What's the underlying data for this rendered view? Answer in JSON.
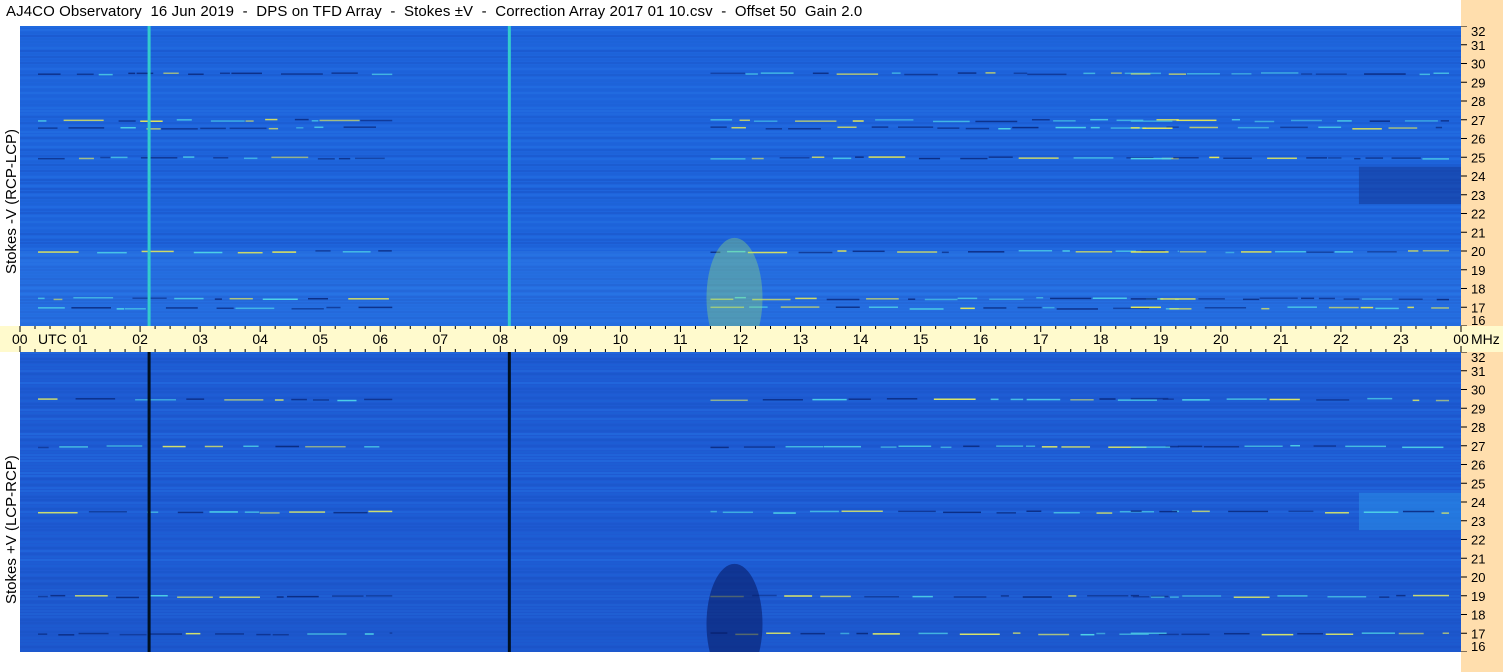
{
  "title": "AJ4CO Observatory  16 Jun 2019  -  DPS on TFD Array  -  Stokes ±V  -  Correction Array 2017 01 10.csv  -  Offset 50  Gain 2.0",
  "chart_data": [
    {
      "type": "heatmap",
      "name": "Stokes -V (RCP-LCP)",
      "ylabel": "Stokes -V (RCP-LCP)",
      "x_ticks": [
        "00",
        "01",
        "02",
        "03",
        "04",
        "05",
        "06",
        "07",
        "08",
        "09",
        "10",
        "11",
        "12",
        "13",
        "14",
        "15",
        "16",
        "17",
        "18",
        "19",
        "20",
        "21",
        "22",
        "23",
        "00"
      ],
      "x_unit": "UTC",
      "xlim": [
        0,
        24
      ],
      "y_ticks": [
        16,
        17,
        18,
        19,
        20,
        21,
        22,
        23,
        24,
        25,
        26,
        27,
        28,
        29,
        30,
        31,
        32
      ],
      "y_unit": "MHz",
      "ylim": [
        16,
        32
      ],
      "vertical_lines_utc": [
        2.15,
        8.15
      ],
      "vertical_line_color": "#33cccc",
      "bright_bands_mhz": [
        17.0,
        17.5,
        20.0,
        25.0,
        26.6,
        27.0,
        29.5
      ],
      "background_color": "#1e64dc",
      "highlight_color": "#f0f050"
    },
    {
      "type": "heatmap",
      "name": "Stokes +V (LCP-RCP)",
      "ylabel": "Stokes +V (LCP-RCP)",
      "x_ticks": [
        "00",
        "01",
        "02",
        "03",
        "04",
        "05",
        "06",
        "07",
        "08",
        "09",
        "10",
        "11",
        "12",
        "13",
        "14",
        "15",
        "16",
        "17",
        "18",
        "19",
        "20",
        "21",
        "22",
        "23",
        "00"
      ],
      "x_unit": "UTC",
      "xlim": [
        0,
        24
      ],
      "y_ticks": [
        16,
        17,
        18,
        19,
        20,
        21,
        22,
        23,
        24,
        25,
        26,
        27,
        28,
        29,
        30,
        31,
        32
      ],
      "y_unit": "MHz",
      "ylim": [
        16,
        32
      ],
      "vertical_lines_utc": [
        2.15,
        8.15
      ],
      "vertical_line_color": "#001020",
      "bright_bands_mhz": [
        17.0,
        19.0,
        23.5,
        27.0,
        29.5
      ],
      "background_color": "#1e5ad2",
      "highlight_color": "#e8f060"
    }
  ]
}
